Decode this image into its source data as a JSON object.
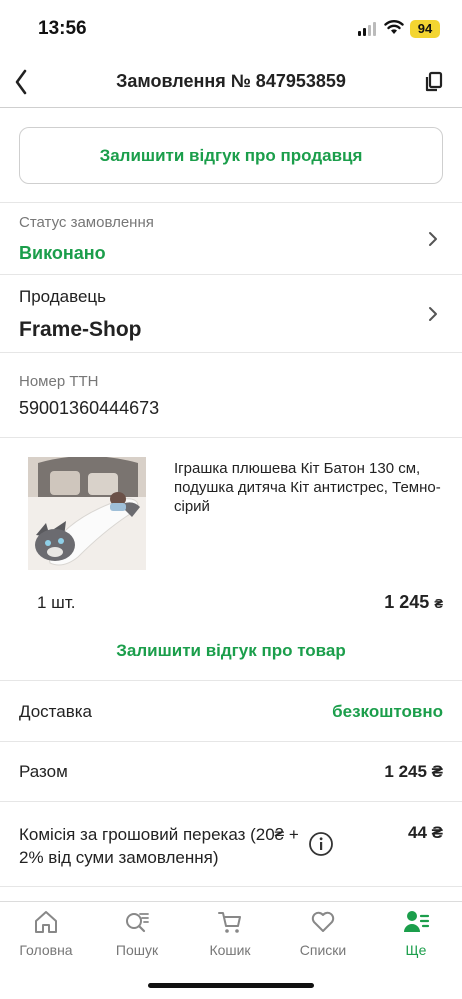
{
  "status_bar": {
    "time": "13:56",
    "battery": "94"
  },
  "header": {
    "title": "Замовлення № 847953859",
    "back_icon": "chevron-left-icon",
    "copy_icon": "copy-icon"
  },
  "seller_review_button": "Залишити відгук про продавця",
  "order_status": {
    "label": "Статус замовлення",
    "value": "Виконано"
  },
  "seller": {
    "label": "Продавець",
    "value": "Frame-Shop"
  },
  "ttn": {
    "label": "Номер ТТН",
    "value": "59001360444673"
  },
  "product": {
    "name": "Іграшка плюшева Кіт Батон 130 см, подушка дитяча Кіт антистрес, Темно-сірий",
    "quantity": "1 шт.",
    "price": "1 245",
    "currency": "₴",
    "review_link": "Залишити відгук про товар"
  },
  "summary": {
    "delivery_label": "Доставка",
    "delivery_value": "безкоштовно",
    "total_label": "Разом",
    "total_value": "1 245 ₴",
    "fee_label": "Комісія за грошовий переказ (20₴ + 2% від суми замовлення)",
    "fee_value": "44 ₴"
  },
  "tabs": [
    {
      "label": "Головна",
      "icon": "home-icon"
    },
    {
      "label": "Пошук",
      "icon": "search-icon"
    },
    {
      "label": "Кошик",
      "icon": "cart-icon"
    },
    {
      "label": "Списки",
      "icon": "heart-icon"
    },
    {
      "label": "Ще",
      "icon": "profile-menu-icon",
      "active": true
    }
  ],
  "colors": {
    "accent": "#1b9e4b",
    "battery": "#f3d531"
  }
}
